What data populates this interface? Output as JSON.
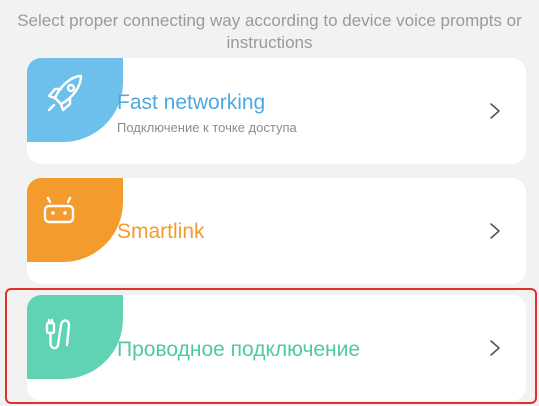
{
  "instructions": "Select proper connecting way according to device voice prompts or instructions",
  "options": [
    {
      "title": "Fast networking",
      "subtitle": "Подключение к точке доступа",
      "icon": "rocket-icon",
      "color": "#6dc0ec"
    },
    {
      "title": "Smartlink",
      "icon": "android-icon",
      "color": "#f39b2c"
    },
    {
      "title": "Проводное подключение",
      "icon": "cable-icon",
      "color": "#5fd3b4",
      "highlighted": true
    }
  ],
  "colors": {
    "background": "#f2f2f2",
    "highlight": "#e0312b"
  }
}
